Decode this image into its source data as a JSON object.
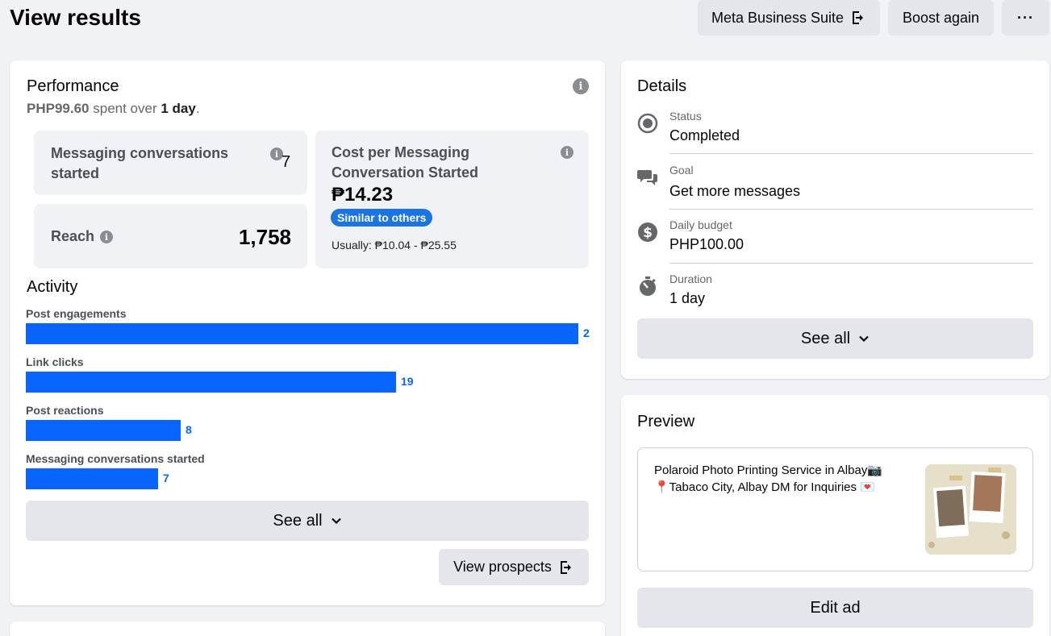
{
  "header": {
    "title": "View results",
    "actions": {
      "business_suite": "Meta Business Suite",
      "boost_again": "Boost again",
      "more": "···"
    }
  },
  "performance": {
    "title": "Performance",
    "spent_amount": "PHP99.60",
    "spent_mid": "spent over",
    "spent_duration": "1 day",
    "spent_end": ".",
    "messaging": {
      "label": "Messaging conversations started",
      "value": "7"
    },
    "reach": {
      "label": "Reach",
      "value": "1,758"
    },
    "cost": {
      "label": "Cost per Messaging Conversation Started",
      "value": "₱14.23",
      "badge": "Similar to others",
      "usually": "Usually: ₱10.04 - ₱25.55"
    }
  },
  "activity": {
    "title": "Activity",
    "items": [
      {
        "label": "Post engagements",
        "value": "2",
        "fill": 1.0
      },
      {
        "label": "Link clicks",
        "value": "19",
        "fill": 0.67
      },
      {
        "label": "Post reactions",
        "value": "8",
        "fill": 0.28
      },
      {
        "label": "Messaging conversations started",
        "value": "7",
        "fill": 0.24
      }
    ],
    "see_all": "See all",
    "view_prospects": "View prospects"
  },
  "details": {
    "title": "Details",
    "rows": [
      {
        "icon": "status-icon",
        "label": "Status",
        "value": "Completed"
      },
      {
        "icon": "chat-bubbles-icon",
        "label": "Goal",
        "value": "Get more messages"
      },
      {
        "icon": "dollar-icon",
        "label": "Daily budget",
        "value": "PHP100.00"
      },
      {
        "icon": "stopwatch-icon",
        "label": "Duration",
        "value": "1 day"
      }
    ],
    "see_all": "See all"
  },
  "preview": {
    "title": "Preview",
    "line1": "Polaroid Photo Printing Service in Albay📷",
    "line2": "📍Tabaco City, Albay DM for Inquiries 💌",
    "edit_ad": "Edit ad"
  },
  "colors": {
    "accent": "#0866ff",
    "badge": "#1b74e4",
    "background": "#f0f2f5",
    "button": "#e4e6eb"
  }
}
